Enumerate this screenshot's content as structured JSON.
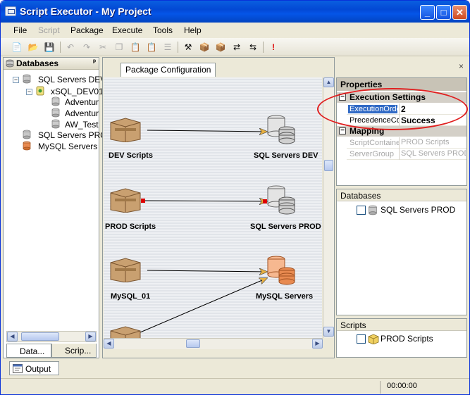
{
  "window": {
    "title": "Script Executor - My Project",
    "min_label": "_",
    "max_label": "□",
    "close_label": "✕"
  },
  "menu": [
    "File",
    "Script",
    "Package",
    "Execute",
    "Tools",
    "Help"
  ],
  "toolbar_icons": [
    "new-icon",
    "open-icon",
    "save-icon",
    "undo-icon",
    "redo-icon",
    "cut-icon",
    "copy-icon",
    "paste-icon",
    "paste-special-icon",
    "properties-icon",
    "tools-icon",
    "package-icon",
    "package-add-icon",
    "swap-icon",
    "connect-icon",
    "execute-icon"
  ],
  "left_panel": {
    "title": "Databases",
    "pin": "ᵖ",
    "tree": [
      {
        "label": "SQL Servers DEV",
        "level": 0,
        "expanded": true
      },
      {
        "label": "xSQL_DEV01",
        "level": 1,
        "expanded": true
      },
      {
        "label": "Adventur",
        "level": 2
      },
      {
        "label": "Adventur",
        "level": 2
      },
      {
        "label": "AW_Test",
        "level": 2
      },
      {
        "label": "SQL Servers PROD",
        "level": 0
      },
      {
        "label": "MySQL Servers",
        "level": 0
      }
    ],
    "tabs": [
      "Data...",
      "Scrip..."
    ]
  },
  "center": {
    "tab_label": "Package Configuration",
    "close_label": "×",
    "nodes": {
      "dev_scripts": "DEV Scripts",
      "sql_dev": "SQL Servers DEV",
      "prod_scripts": "PROD Scripts",
      "sql_prod": "SQL Servers PROD",
      "mysql_01": "MySQL_01",
      "mysql_servers": "MySQL Servers"
    }
  },
  "properties": {
    "title": "Properties",
    "categories": [
      {
        "name": "Execution Settings",
        "rows": [
          {
            "name": "ExecutionOrder",
            "value": "2",
            "selected": true
          },
          {
            "name": "PrecedenceCo",
            "value": "Success"
          }
        ]
      },
      {
        "name": "Mapping",
        "rows": [
          {
            "name": "ScriptContainer",
            "value": "PROD Scripts",
            "disabled": true
          },
          {
            "name": "ServerGroup",
            "value": "SQL Servers PROD",
            "disabled": true
          }
        ]
      }
    ]
  },
  "databases_panel": {
    "title": "Databases",
    "item": "SQL Servers PROD"
  },
  "scripts_panel": {
    "title": "Scripts",
    "item": "PROD Scripts"
  },
  "bottom": {
    "output_tab": "Output",
    "timer": "00:00:00"
  },
  "colors": {
    "accent": "#316ac5",
    "highlight_oval": "#e02020",
    "mysql_orange": "#e88a50"
  }
}
